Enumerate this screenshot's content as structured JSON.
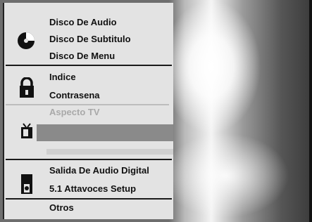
{
  "menu": {
    "items": [
      {
        "label": "Disco De Audio",
        "state": "normal"
      },
      {
        "label": "Disco De Subtitulo",
        "state": "normal"
      },
      {
        "label": "Disco De Menu",
        "state": "normal"
      },
      {
        "label": "Indice",
        "state": "normal"
      },
      {
        "label": "Contrasena",
        "state": "normal"
      },
      {
        "label": "Aspecto TV",
        "state": "dimmed"
      },
      {
        "label": "Salida De Audio Digital",
        "state": "normal"
      },
      {
        "label": "5.1 Attavoces Setup",
        "state": "normal"
      },
      {
        "label": "Otros",
        "state": "normal"
      }
    ]
  },
  "icons": {
    "disc": "disc-icon",
    "lock": "lock-icon",
    "tv": "tv-icon",
    "speaker": "speaker-icon"
  },
  "colors": {
    "menu_bg": "#e3e3e3",
    "text": "#111111",
    "dimmed_text": "#a9a9a9",
    "highlight_bar": "#8a8a8a"
  }
}
